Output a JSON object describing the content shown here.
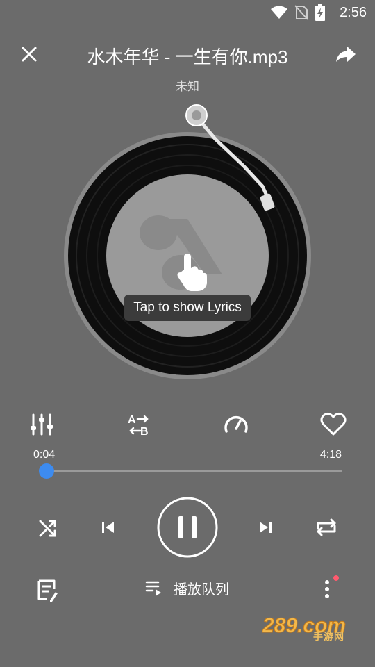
{
  "status_bar": {
    "time": "2:56",
    "icons": [
      "wifi-icon",
      "no-sim-icon",
      "battery-charging-icon"
    ]
  },
  "header": {
    "title": "水木年华 - 一生有你.mp3",
    "artist": "未知",
    "close_icon": "close-icon",
    "share_icon": "share-icon"
  },
  "disc": {
    "tooltip": "Tap to show Lyrics"
  },
  "functions": [
    "equalizer-icon",
    "ab-repeat-icon",
    "speed-icon",
    "favorite-icon"
  ],
  "progress": {
    "current": "0:04",
    "total": "4:18",
    "fraction": 0.016
  },
  "controls": [
    "shuffle-icon",
    "previous-icon",
    "pause-icon",
    "next-icon",
    "repeat-icon"
  ],
  "bottom": {
    "queue_label": "播放队列"
  },
  "watermark": {
    "text": "289.com",
    "sub": "手游网"
  },
  "colors": {
    "background": "#6b6b6b",
    "accent": "#3d8bef",
    "badge": "#ff5a6e"
  }
}
